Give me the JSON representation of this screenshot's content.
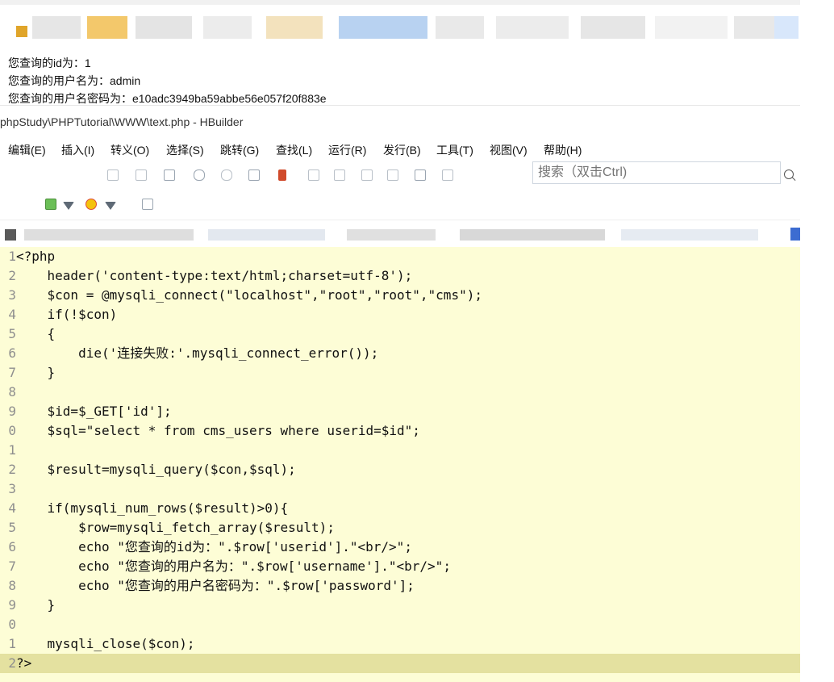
{
  "browser_output": {
    "lines": [
      "您查询的id为：1",
      "您查询的用户名为：admin",
      "您查询的用户名密码为：e10adc3949ba59abbe56e057f20f883e"
    ]
  },
  "window": {
    "title": "phpStudy\\PHPTutorial\\WWW\\text.php  -  HBuilder"
  },
  "menu": {
    "items": [
      "编辑(E)",
      "插入(I)",
      "转义(O)",
      "选择(S)",
      "跳转(G)",
      "查找(L)",
      "运行(R)",
      "发行(B)",
      "工具(T)",
      "视图(V)",
      "帮助(H)"
    ]
  },
  "search": {
    "placeholder": "搜索（双击Ctrl)"
  },
  "editor": {
    "lines": [
      {
        "n": "1",
        "code": "<?php"
      },
      {
        "n": "2",
        "code": "    header('content-type:text/html;charset=utf-8');"
      },
      {
        "n": "3",
        "code": "    $con = @mysqli_connect(\"localhost\",\"root\",\"root\",\"cms\");"
      },
      {
        "n": "4",
        "code": "    if(!$con)"
      },
      {
        "n": "5",
        "code": "    {"
      },
      {
        "n": "6",
        "code": "        die('连接失败:'.mysqli_connect_error());"
      },
      {
        "n": "7",
        "code": "    }"
      },
      {
        "n": "8",
        "code": ""
      },
      {
        "n": "9",
        "code": "    $id=$_GET['id'];"
      },
      {
        "n": "0",
        "code": "    $sql=\"select * from cms_users where userid=$id\";"
      },
      {
        "n": "1",
        "code": ""
      },
      {
        "n": "2",
        "code": "    $result=mysqli_query($con,$sql);"
      },
      {
        "n": "3",
        "code": ""
      },
      {
        "n": "4",
        "code": "    if(mysqli_num_rows($result)>0){"
      },
      {
        "n": "5",
        "code": "        $row=mysqli_fetch_array($result);"
      },
      {
        "n": "6",
        "code": "        echo \"您查询的id为：\".$row['userid'].\"<br/>\";"
      },
      {
        "n": "7",
        "code": "        echo \"您查询的用户名为：\".$row['username'].\"<br/>\";"
      },
      {
        "n": "8",
        "code": "        echo \"您查询的用户名密码为：\".$row['password'];"
      },
      {
        "n": "9",
        "code": "    }"
      },
      {
        "n": "0",
        "code": ""
      },
      {
        "n": "1",
        "code": "    mysqli_close($con);"
      },
      {
        "n": "2",
        "code": "?>"
      }
    ]
  },
  "colors": {
    "editor_bg": "#fdfdd6",
    "active_line": "#e4e1a0",
    "keyword": "#d1252a",
    "string": "#2c8f7f",
    "number": "#8b3dd6"
  },
  "icons": [
    "bookmark-icon",
    "arrow-back-icon",
    "arrow-forward-icon",
    "search-icon",
    "dropdown-icon",
    "info-icon"
  ]
}
